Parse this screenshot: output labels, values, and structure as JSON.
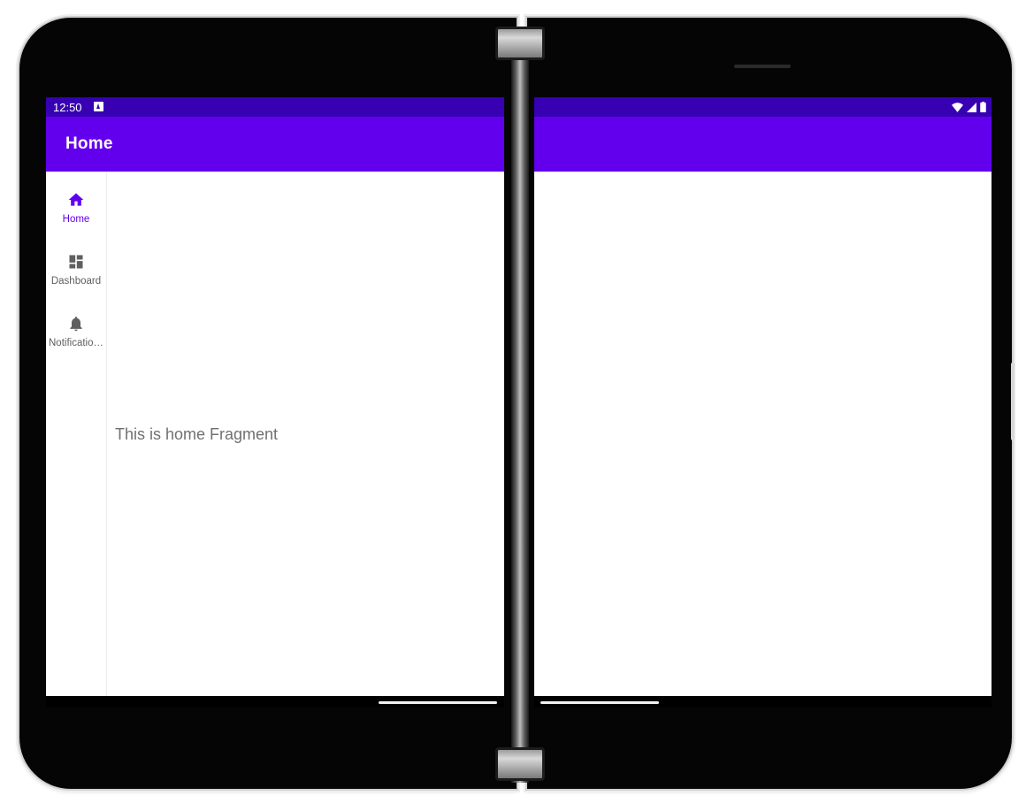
{
  "status_bar": {
    "time": "12:50"
  },
  "app_bar": {
    "title": "Home"
  },
  "nav_rail": {
    "items": [
      {
        "label": "Home",
        "icon": "home-icon",
        "active": true
      },
      {
        "label": "Dashboard",
        "icon": "dashboard-icon",
        "active": false
      },
      {
        "label": "Notificatio…",
        "icon": "bell-icon",
        "active": false
      }
    ]
  },
  "content": {
    "fragment_text": "This is home Fragment"
  },
  "colors": {
    "status_bar": "#3700b3",
    "app_bar": "#6200ee",
    "active_nav": "#6200ee",
    "inactive_nav": "#5f5f5f"
  }
}
